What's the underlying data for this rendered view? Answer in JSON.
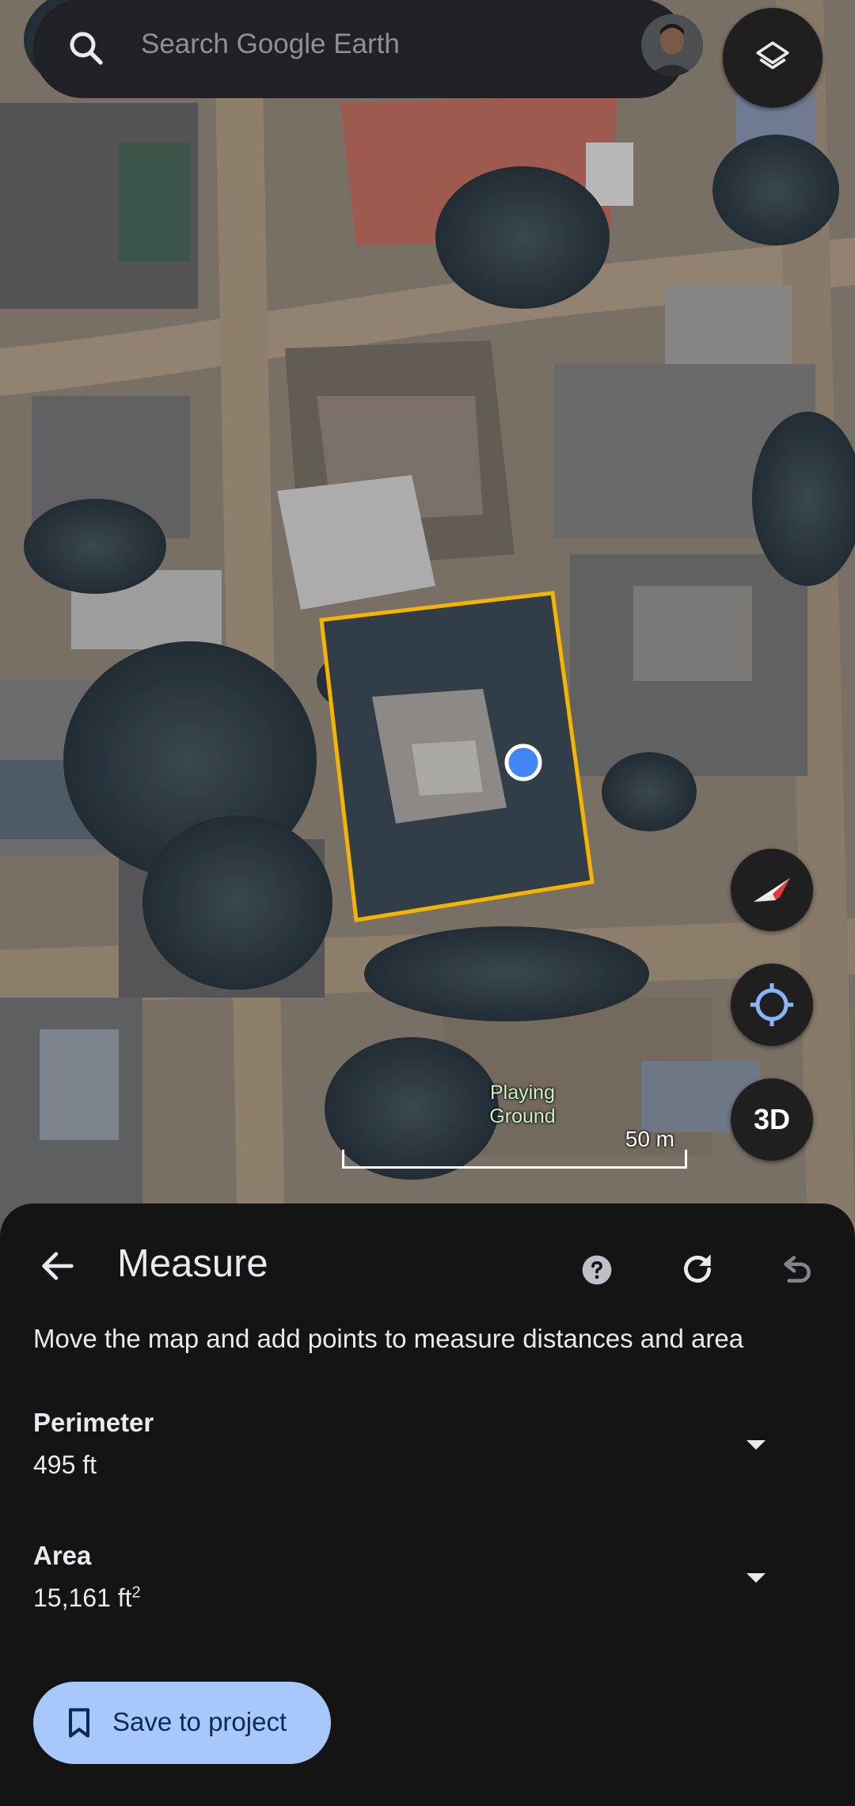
{
  "search": {
    "placeholder": "Search Google Earth",
    "search_icon": "search-icon",
    "avatar_icon": "avatar"
  },
  "map": {
    "place_label_line1": "Playing",
    "place_label_line2": "Ground",
    "scale_label": "50 m",
    "measure_outline_color": "#f4b400",
    "point_color": "#4285f4"
  },
  "controls": {
    "layers_icon": "layers-icon",
    "compass_icon": "compass-icon",
    "locate_icon": "my-location-icon",
    "threed_label": "3D"
  },
  "measure": {
    "title": "Measure",
    "help_icon": "help-icon",
    "redo_icon": "redo-icon",
    "undo_icon": "undo-icon",
    "back_icon": "back-arrow-icon",
    "instructions": "Move the map and add points to measure distances and area",
    "perimeter": {
      "label": "Perimeter",
      "value": "495 ft"
    },
    "area": {
      "label": "Area",
      "value": "15,161 ft",
      "unit_sup": "2"
    },
    "save_label": "Save to project"
  },
  "colors": {
    "sheet_bg": "#141414",
    "save_button_bg": "#a8c7fa",
    "save_button_text": "#0b2a56"
  }
}
